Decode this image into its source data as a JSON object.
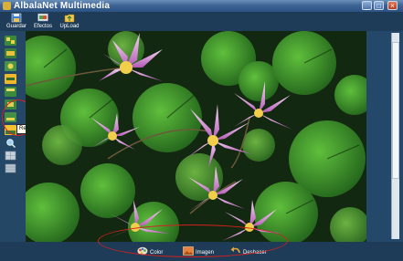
{
  "window": {
    "title": "AlbalaNet Multimedia"
  },
  "toolbar": {
    "items": [
      {
        "label": "Guardar",
        "icon": "save-disk-icon"
      },
      {
        "label": "Efectos",
        "icon": "effects-icon"
      },
      {
        "label": "UpLoad",
        "icon": "upload-folder-icon"
      }
    ]
  },
  "sidebar": {
    "tooltip": "Resaltar Segmento",
    "tools": [
      "segment-tool-icon",
      "segment-tool-icon",
      "segment-tool-icon",
      "highlight-tool-icon",
      "segment-tool-icon",
      "segment-tool-icon",
      "segment-tool-icon",
      "highlight-segment-icon",
      "search-icon",
      "grid-icon",
      "grid-icon"
    ]
  },
  "bottombar": {
    "items": [
      {
        "label": "Color",
        "icon": "palette-icon"
      },
      {
        "label": "Imagen",
        "icon": "image-icon"
      },
      {
        "label": "Deshacer",
        "icon": "undo-icon"
      }
    ]
  },
  "colors": {
    "titlebar": "#3e6496",
    "panel": "#234765",
    "accent_red": "#d42020"
  }
}
